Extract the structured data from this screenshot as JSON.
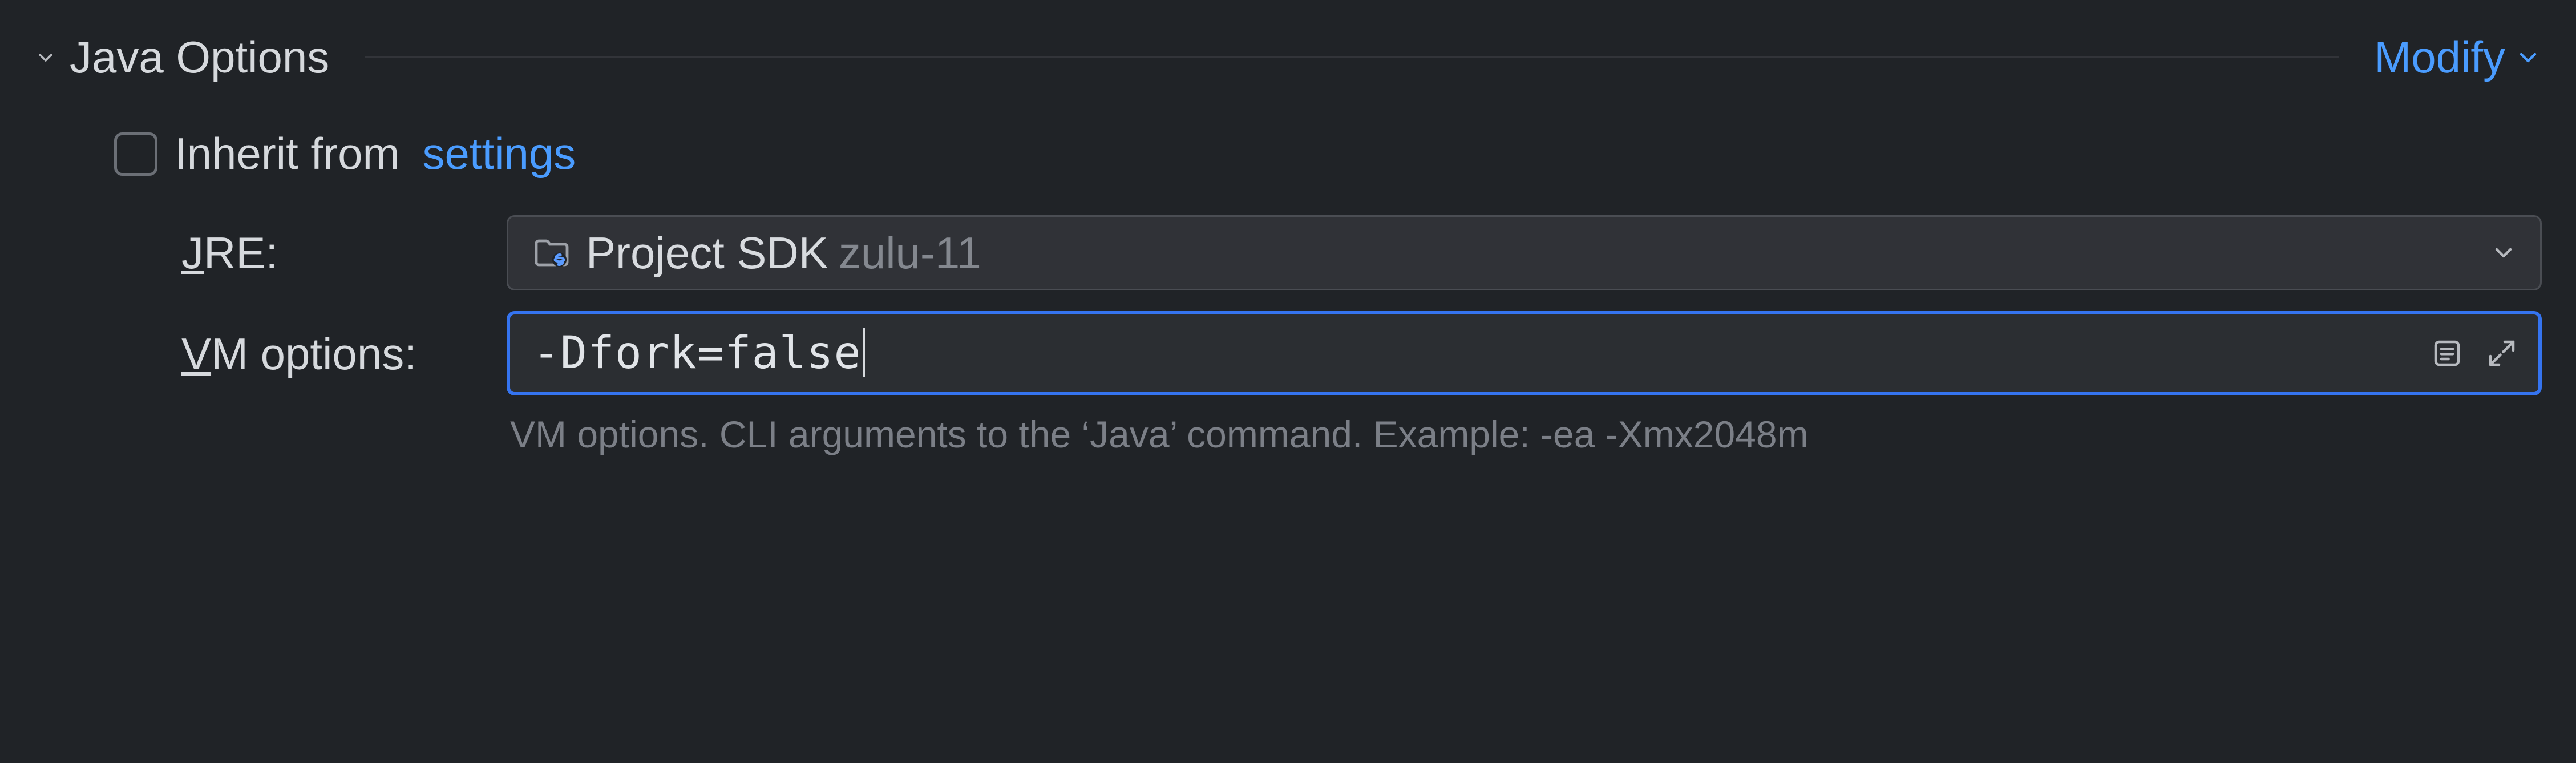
{
  "section": {
    "title": "Java Options",
    "modify_label": "Modify"
  },
  "inherit": {
    "checked": false,
    "label": "Inherit from",
    "link_label": "settings"
  },
  "jre": {
    "label_pre": "J",
    "label_rest": "RE:",
    "value_main": "Project SDK",
    "value_sub": "zulu-11"
  },
  "vm": {
    "label_pre": "V",
    "label_rest": "M options:",
    "value": "-Dfork=false",
    "hint": "VM options. CLI arguments to the ‘Java’ command. Example: -ea -Xmx2048m"
  }
}
